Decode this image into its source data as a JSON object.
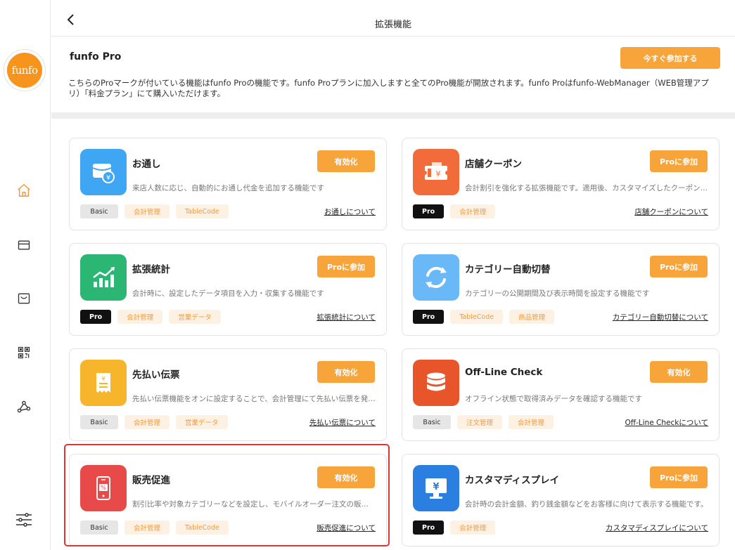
{
  "header": {
    "title": "拡張機能"
  },
  "sidebar": {
    "logo_text": "funfo"
  },
  "pro": {
    "title": "funfo Pro",
    "join_label": "今すぐ参加する",
    "description": "こちらのProマークが付いている機能はfunfo Proの機能です。funfo Proプランに加入しますと全てのPro機能が開放されます。funfo Proはfunfo-WebManager（WEB管理アプリ）「料金プラン」にて購入いただけます。"
  },
  "cards": [
    {
      "title": "お通し",
      "desc": "来店人数に応じ、自動的にお通し代金を追加する機能です",
      "button": "有効化",
      "tags": [
        "Basic",
        "会計管理",
        "TableCode"
      ],
      "link": "お通しについて"
    },
    {
      "title": "店舗クーポン",
      "desc": "会計割引を強化する拡張機能です。適用後、カスタマイズしたクーポンを発行できます",
      "button": "Proに参加",
      "tags": [
        "Pro",
        "会計管理"
      ],
      "link": "店舗クーポンについて"
    },
    {
      "title": "拡張統計",
      "desc": "会計時に、設定したデータ項目を入力・収集する機能です",
      "button": "Proに参加",
      "tags": [
        "Pro",
        "会計管理",
        "営業データ"
      ],
      "link": "拡張統計について"
    },
    {
      "title": "カテゴリー自動切替",
      "desc": "カテゴリーの公開期間及び表示時間を設定する機能です",
      "button": "Proに参加",
      "tags": [
        "Pro",
        "TableCode",
        "商品管理"
      ],
      "link": "カテゴリー自動切替について"
    },
    {
      "title": "先払い伝票",
      "desc": "先払い伝票機能をオンに設定することで、会計管理にて先払い伝票を発行できます",
      "button": "有効化",
      "tags": [
        "Basic",
        "会計管理",
        "営業データ"
      ],
      "link": "先払い伝票について"
    },
    {
      "title": "Off-Line Check",
      "desc": "オフライン状態で取得済みデータを確認する機能です",
      "button": "有効化",
      "tags": [
        "Basic",
        "注文管理",
        "会計管理"
      ],
      "link": "Off-Line Checkについて"
    },
    {
      "title": "販売促進",
      "desc": "割引比率や対象カテゴリーなどを設定し、モバイルオーダー注文の販売を促進します",
      "button": "有効化",
      "tags": [
        "Basic",
        "会計管理",
        "TableCode"
      ],
      "link": "販売促進について"
    },
    {
      "title": "カスタマディスプレイ",
      "desc": "会計時の会計金額、釣り銭金額などをお客様に向けて表示する機能です。",
      "button": "Proに参加",
      "tags": [
        "Pro",
        "会計管理"
      ],
      "link": "カスタマディスプレイについて"
    }
  ],
  "colors": {
    "accent": "#f7a43a",
    "highlight": "#e03434",
    "icon_otoshi": "#3ea6f2",
    "icon_coupon": "#f26b3a",
    "icon_stats": "#2bb673",
    "icon_category": "#69b8f7",
    "icon_prepay": "#f7b52c",
    "icon_offline": "#e8552b",
    "icon_promo": "#e84a4a",
    "icon_display": "#2b7fe0"
  }
}
